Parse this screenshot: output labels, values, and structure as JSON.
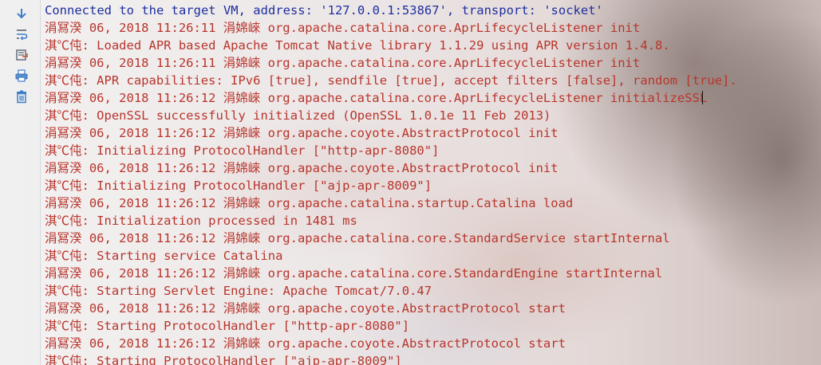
{
  "toolbar": {
    "icons": [
      "down-arrow-icon",
      "soft-wrap-icon",
      "scroll-to-end-icon",
      "print-icon",
      "trash-icon"
    ]
  },
  "console": {
    "lines": [
      {
        "text": "Connected to the target VM, address: '127.0.0.1:53867', transport: 'socket'",
        "kind": "info"
      },
      {
        "text": "涓冩湀 06, 2018 11:26:11 涓婂崍 org.apache.catalina.core.AprLifecycleListener init",
        "kind": "err"
      },
      {
        "text": "淇℃伅: Loaded APR based Apache Tomcat Native library 1.1.29 using APR version 1.4.8.",
        "kind": "err"
      },
      {
        "text": "涓冩湀 06, 2018 11:26:11 涓婂崍 org.apache.catalina.core.AprLifecycleListener init",
        "kind": "err"
      },
      {
        "text": "淇℃伅: APR capabilities: IPv6 [true], sendfile [true], accept filters [false], random [true].",
        "kind": "err"
      },
      {
        "text": "涓冩湀 06, 2018 11:26:12 涓婂崍 org.apache.catalina.core.AprLifecycleListener initializeSSL",
        "kind": "err"
      },
      {
        "text": "淇℃伅: OpenSSL successfully initialized (OpenSSL 1.0.1e 11 Feb 2013)",
        "kind": "err"
      },
      {
        "text": "涓冩湀 06, 2018 11:26:12 涓婂崍 org.apache.coyote.AbstractProtocol init",
        "kind": "err"
      },
      {
        "text": "淇℃伅: Initializing ProtocolHandler [\"http-apr-8080\"]",
        "kind": "err"
      },
      {
        "text": "涓冩湀 06, 2018 11:26:12 涓婂崍 org.apache.coyote.AbstractProtocol init",
        "kind": "err"
      },
      {
        "text": "淇℃伅: Initializing ProtocolHandler [\"ajp-apr-8009\"]",
        "kind": "err"
      },
      {
        "text": "涓冩湀 06, 2018 11:26:12 涓婂崍 org.apache.catalina.startup.Catalina load",
        "kind": "err"
      },
      {
        "text": "淇℃伅: Initialization processed in 1481 ms",
        "kind": "err"
      },
      {
        "text": "涓冩湀 06, 2018 11:26:12 涓婂崍 org.apache.catalina.core.StandardService startInternal",
        "kind": "err"
      },
      {
        "text": "淇℃伅: Starting service Catalina",
        "kind": "err"
      },
      {
        "text": "涓冩湀 06, 2018 11:26:12 涓婂崍 org.apache.catalina.core.StandardEngine startInternal",
        "kind": "err"
      },
      {
        "text": "淇℃伅: Starting Servlet Engine: Apache Tomcat/7.0.47",
        "kind": "err"
      },
      {
        "text": "涓冩湀 06, 2018 11:26:12 涓婂崍 org.apache.coyote.AbstractProtocol start",
        "kind": "err"
      },
      {
        "text": "淇℃伅: Starting ProtocolHandler [\"http-apr-8080\"]",
        "kind": "err"
      },
      {
        "text": "涓冩湀 06, 2018 11:26:12 涓婂崍 org.apache.coyote.AbstractProtocol start",
        "kind": "err"
      },
      {
        "text": "淇℃伅: Starting ProtocolHandler [\"ajp-apr-8009\"]",
        "kind": "err"
      }
    ]
  },
  "colors": {
    "info_text": "#1f2f9e",
    "log_text": "#b8352c"
  }
}
